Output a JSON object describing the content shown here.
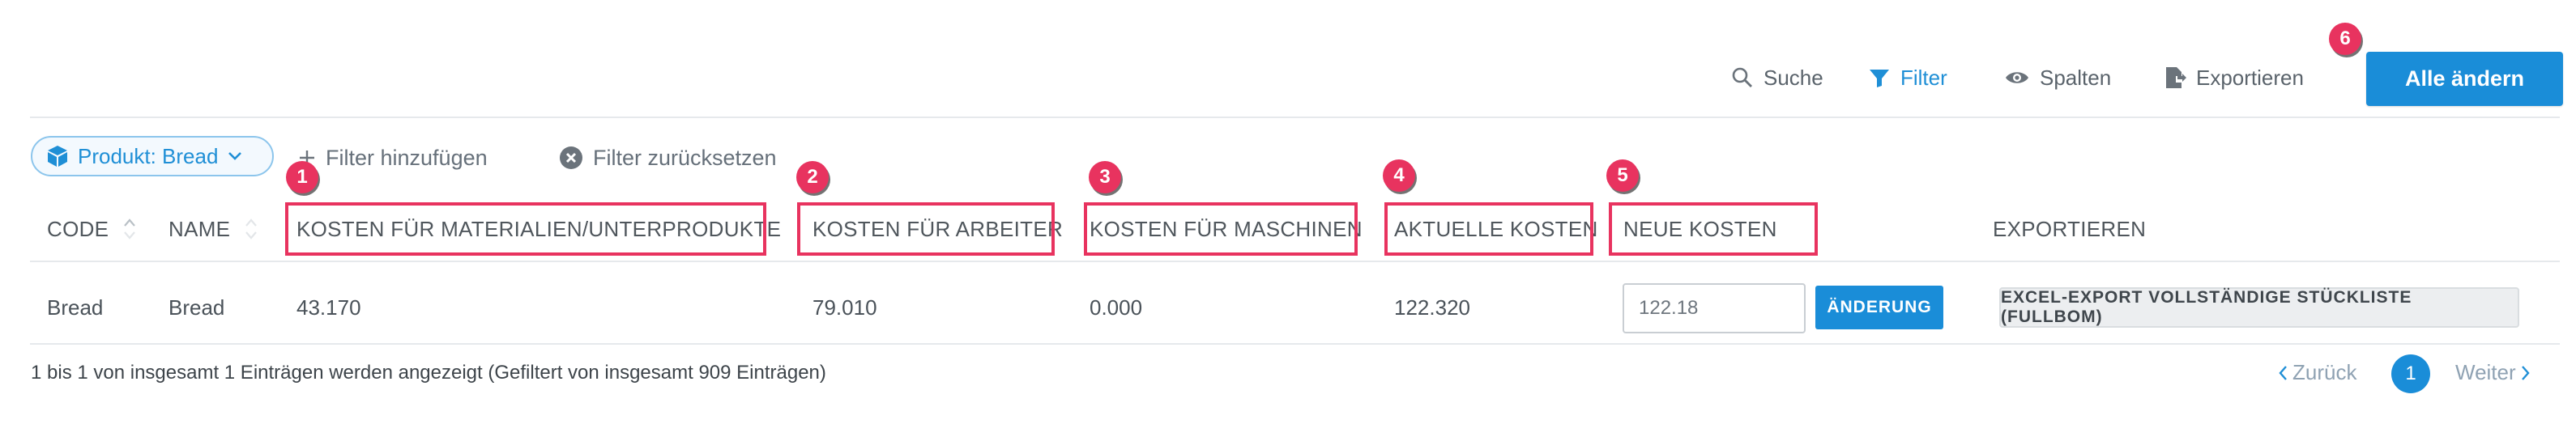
{
  "toolbar": {
    "search_label": "Suche",
    "filter_label": "Filter",
    "columns_label": "Spalten",
    "export_label": "Exportieren",
    "change_all_label": "Alle ändern"
  },
  "filters": {
    "chip_label": "Produkt: Bread",
    "add_filter_label": "Filter hinzufügen",
    "reset_filter_label": "Filter zurücksetzen"
  },
  "table": {
    "headers": [
      "CODE",
      "NAME",
      "KOSTEN FÜR MATERIALIEN/UNTERPRODUKTE",
      "KOSTEN FÜR ARBEITER",
      "KOSTEN FÜR MASCHINEN",
      "AKTUELLE KOSTEN",
      "NEUE KOSTEN",
      "EXPORTIEREN"
    ],
    "rows": [
      {
        "code": "Bread",
        "name": "Bread",
        "material_cost": "43.170",
        "worker_cost": "79.010",
        "machine_cost": "0.000",
        "current_cost": "122.320",
        "new_cost_value": "122.18",
        "change_label": "ÄNDERUNG",
        "export_label": "EXCEL-EXPORT VOLLSTÄNDIGE STÜCKLISTE (FULLBOM)"
      }
    ]
  },
  "annotations": [
    "1",
    "2",
    "3",
    "4",
    "5",
    "6"
  ],
  "footer": {
    "info": "1 bis 1 von insgesamt 1 Einträgen werden angezeigt (Gefiltert von insgesamt 909 Einträgen)",
    "prev_label": "Zurück",
    "page": "1",
    "next_label": "Weiter"
  },
  "colors": {
    "accent": "#1a8dd8",
    "highlight": "#e8335f"
  },
  "icons": [
    "search-icon",
    "filter-icon",
    "eye-icon",
    "file-export-icon",
    "cube-icon",
    "chevron-down-icon",
    "plus-icon",
    "clear-circle-icon",
    "sort-icon",
    "chevron-left-icon",
    "chevron-right-icon"
  ]
}
